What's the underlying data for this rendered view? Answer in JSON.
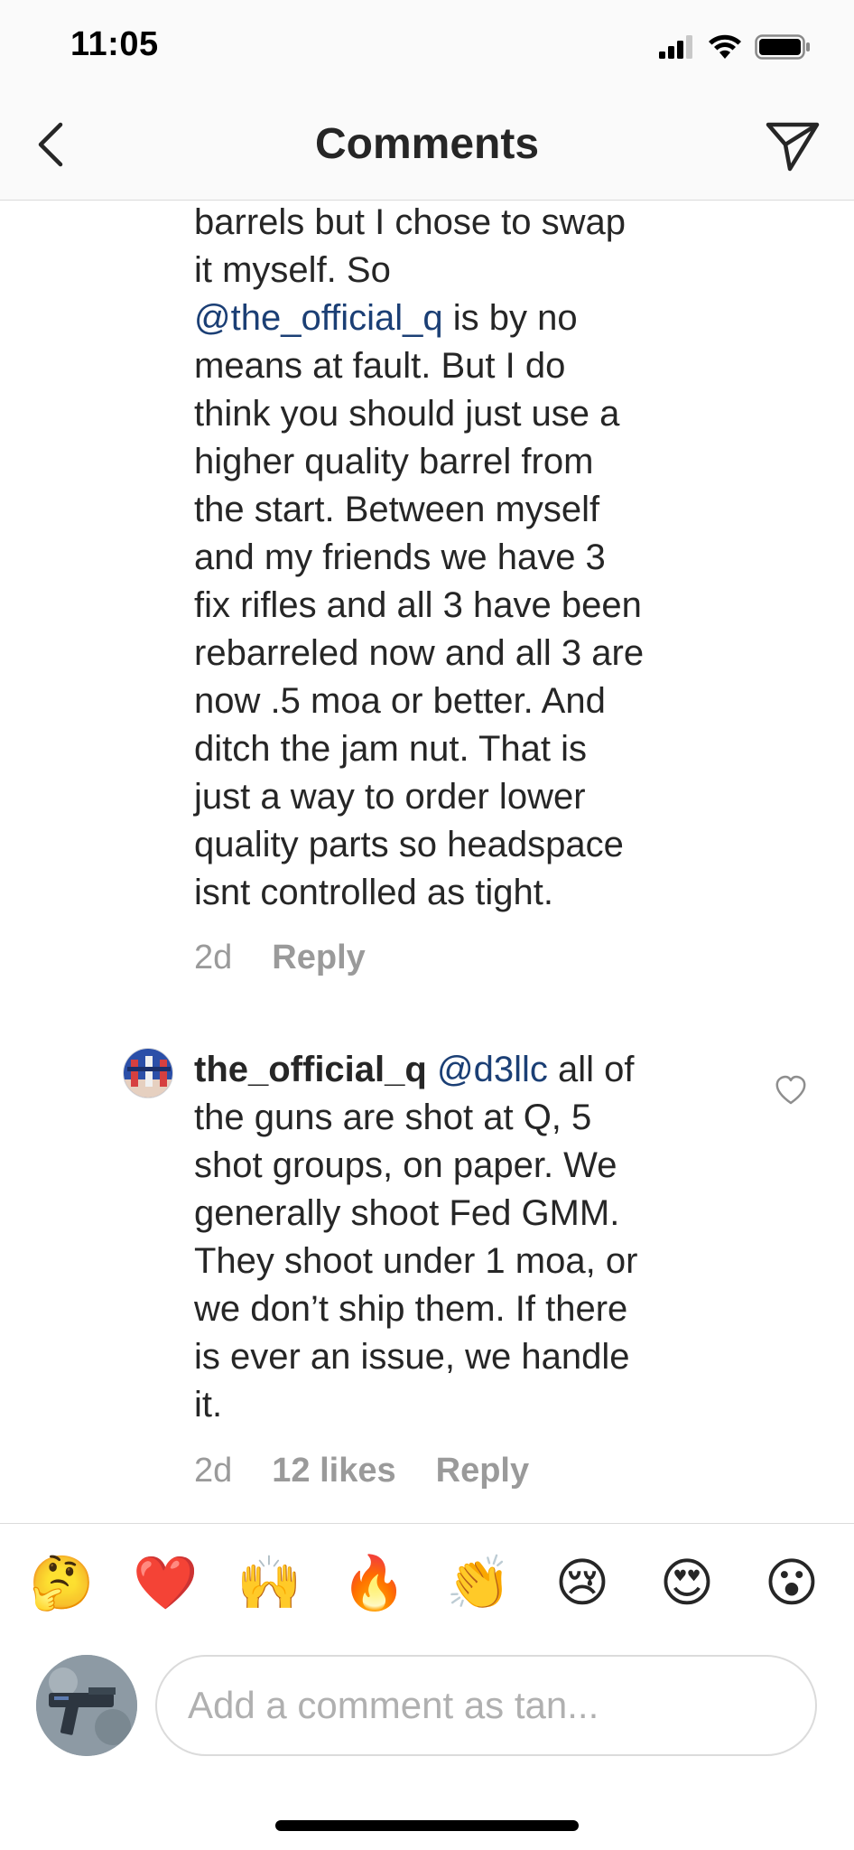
{
  "status_bar": {
    "time": "11:05"
  },
  "nav": {
    "title": "Comments"
  },
  "comment_1": {
    "lines": [
      "barrels but I chose to swap",
      "it myself.  So",
      "@the_official_q",
      " is by no",
      "means at fault.  But I do",
      "think you should just use a",
      "higher quality barrel from",
      "the start.  Between myself",
      "and my friends we have 3",
      "fix rifles and all 3 have been",
      "rebarreled now and all 3 are",
      "now .5 moa or better.  And",
      "ditch the jam nut.  That is",
      "just a way to order lower",
      "quality parts so headspace",
      "isnt controlled as tight."
    ],
    "time": "2d",
    "reply_label": "Reply"
  },
  "comment_2": {
    "username": "the_official_q",
    "mention": "@d3llc",
    "line1_rest": " all of",
    "lines": [
      "the guns are shot at Q, 5",
      "shot groups, on paper. We",
      "generally shoot Fed GMM.",
      "They shoot under 1 moa, or",
      "we don’t ship them. If there",
      "is ever an issue, we handle",
      "it."
    ],
    "time": "2d",
    "likes": "12 likes",
    "reply_label": "Reply"
  },
  "emoji_bar": [
    "🤔",
    "❤️",
    "🙌",
    "🔥",
    "👏",
    "😢",
    "😍",
    "😮"
  ],
  "composer": {
    "placeholder": "Add a comment as tan..."
  },
  "colors": {
    "mention": "#1b3f75",
    "meta": "#9a9a9a",
    "divider": "#dbdbdb"
  }
}
